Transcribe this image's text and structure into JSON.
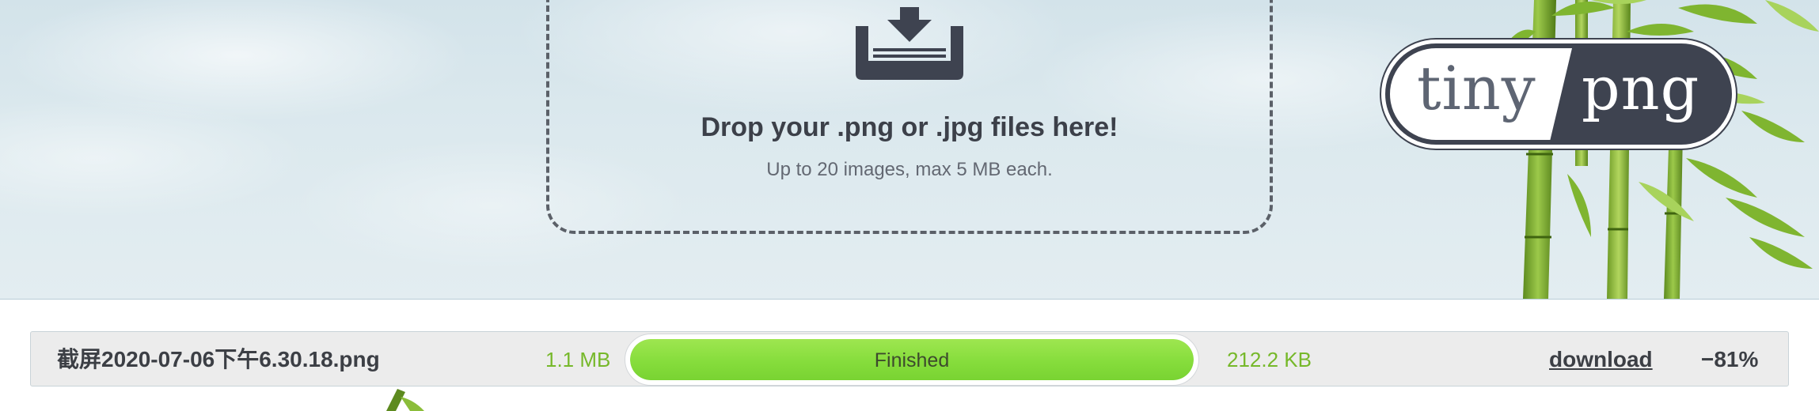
{
  "dropzone": {
    "title": "Drop your .png or .jpg files here!",
    "subtitle": "Up to 20 images, max 5 MB each.",
    "icon": "download-tray-icon"
  },
  "logo": {
    "left_text": "tiny",
    "right_text": "png"
  },
  "results": [
    {
      "filename": "截屏2020-07-06下午6.30.18.png",
      "original_size": "1.1 MB",
      "status": "Finished",
      "progress": 1.0,
      "new_size": "212.2 KB",
      "download_label": "download",
      "savings": "−81%"
    }
  ],
  "colors": {
    "accent_green": "#76b82a",
    "progress_green": "#86dd3c",
    "dark_text": "#3c3f45",
    "logo_dark": "#3e4350",
    "dashed_border": "#5b6068"
  }
}
